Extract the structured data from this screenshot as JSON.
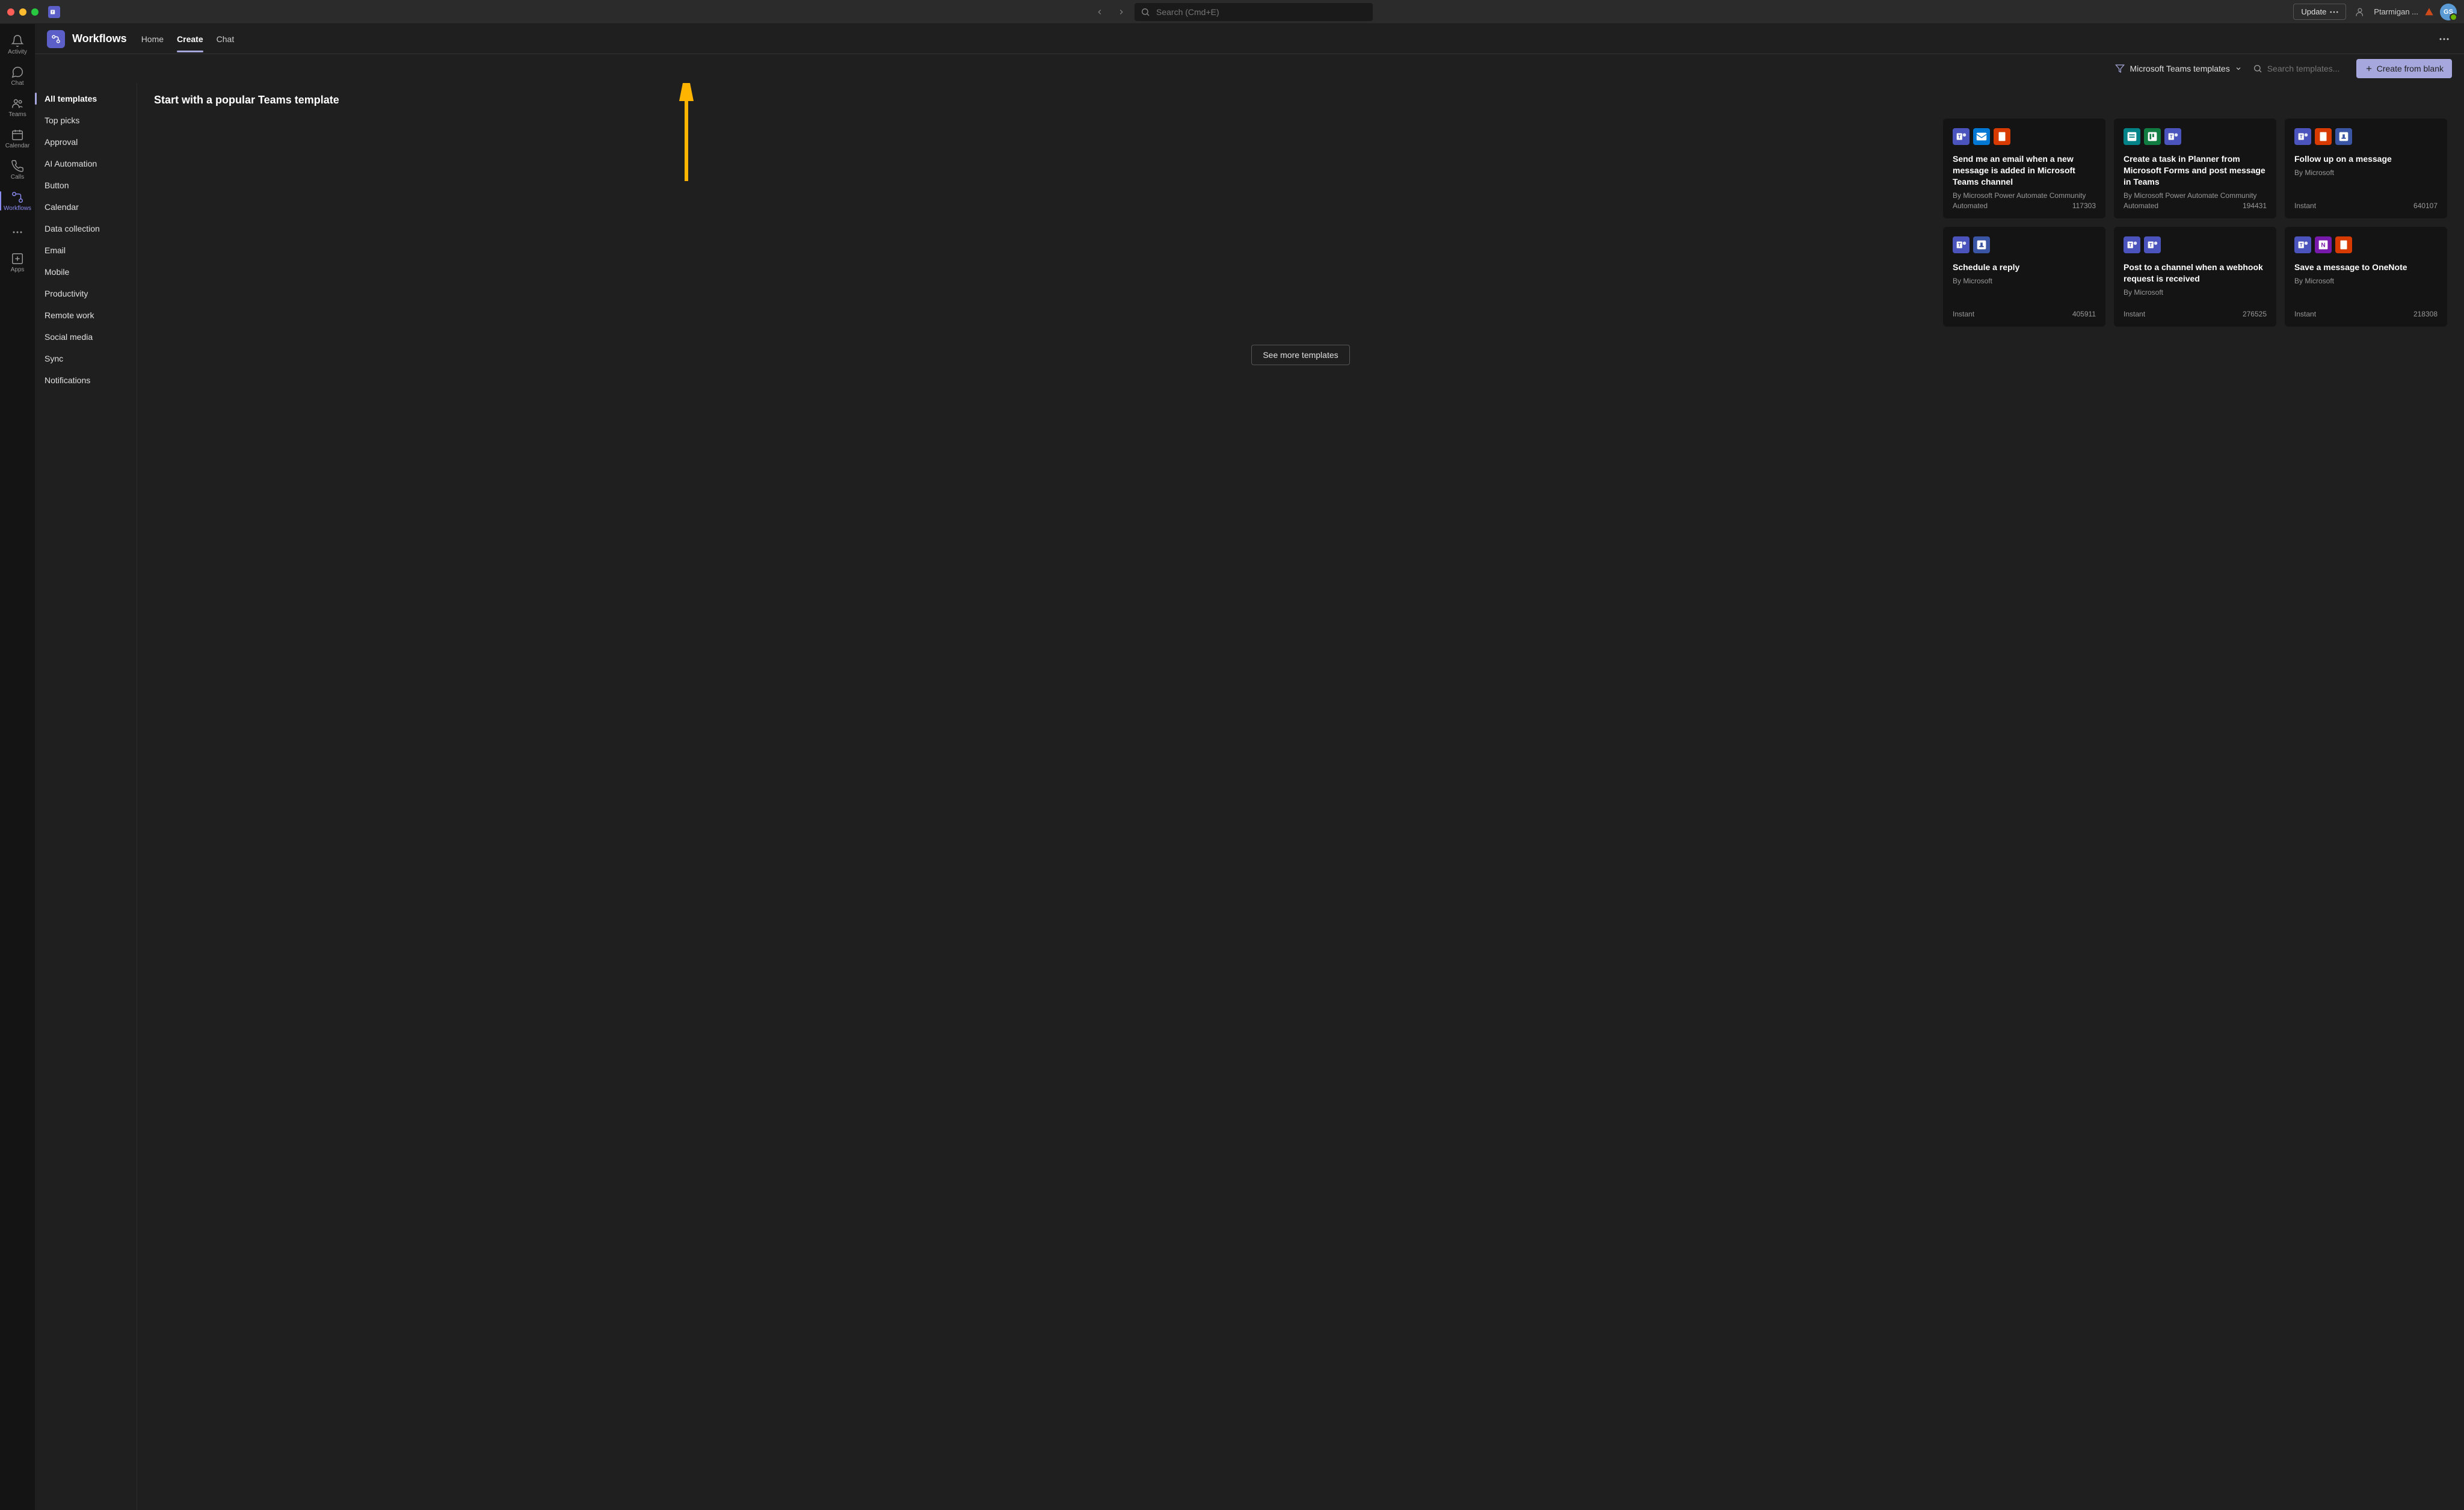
{
  "titlebar": {
    "search_placeholder": "Search (Cmd+E)",
    "update_label": "Update",
    "username": "Ptarmigan ...",
    "avatar_initials": "GS"
  },
  "rail": {
    "items": [
      {
        "label": "Activity",
        "active": false
      },
      {
        "label": "Chat",
        "active": false
      },
      {
        "label": "Teams",
        "active": false
      },
      {
        "label": "Calendar",
        "active": false
      },
      {
        "label": "Calls",
        "active": false
      },
      {
        "label": "Workflows",
        "active": true
      }
    ],
    "apps_label": "Apps"
  },
  "header": {
    "title": "Workflows",
    "tabs": [
      {
        "label": "Home",
        "active": false
      },
      {
        "label": "Create",
        "active": true
      },
      {
        "label": "Chat",
        "active": false
      }
    ]
  },
  "toolbar": {
    "filter_label": "Microsoft Teams templates",
    "search_placeholder": "Search templates...",
    "create_blank_label": "Create from blank"
  },
  "sidebar": {
    "items": [
      {
        "label": "All templates",
        "active": true
      },
      {
        "label": "Top picks"
      },
      {
        "label": "Approval"
      },
      {
        "label": "AI Automation"
      },
      {
        "label": "Button"
      },
      {
        "label": "Calendar"
      },
      {
        "label": "Data collection"
      },
      {
        "label": "Email"
      },
      {
        "label": "Mobile"
      },
      {
        "label": "Productivity"
      },
      {
        "label": "Remote work"
      },
      {
        "label": "Social media"
      },
      {
        "label": "Sync"
      },
      {
        "label": "Notifications"
      }
    ]
  },
  "pane": {
    "title": "Start with a popular Teams template",
    "see_more_label": "See more templates",
    "templates": [
      {
        "title": "Send me an email when a new message is added in Microsoft Teams channel",
        "by": "By Microsoft Power Automate Community",
        "type": "Automated",
        "count": "117303",
        "icons": [
          "teams",
          "outlook",
          "office"
        ]
      },
      {
        "title": "Create a task in Planner from Microsoft Forms and post message in Teams",
        "by": "By Microsoft Power Automate Community",
        "type": "Automated",
        "count": "194431",
        "icons": [
          "forms",
          "planner",
          "teams"
        ]
      },
      {
        "title": "Follow up on a message",
        "by": "By Microsoft",
        "type": "Instant",
        "count": "640107",
        "icons": [
          "teams",
          "office",
          "sched2"
        ]
      },
      {
        "title": "Schedule a reply",
        "by": "By Microsoft",
        "type": "Instant",
        "count": "405911",
        "icons": [
          "teams",
          "sched2"
        ]
      },
      {
        "title": "Post to a channel when a webhook request is received",
        "by": "By Microsoft",
        "type": "Instant",
        "count": "276525",
        "icons": [
          "teams",
          "teams"
        ]
      },
      {
        "title": "Save a message to OneNote",
        "by": "By Microsoft",
        "type": "Instant",
        "count": "218308",
        "icons": [
          "teams",
          "onenote",
          "office"
        ]
      }
    ]
  }
}
